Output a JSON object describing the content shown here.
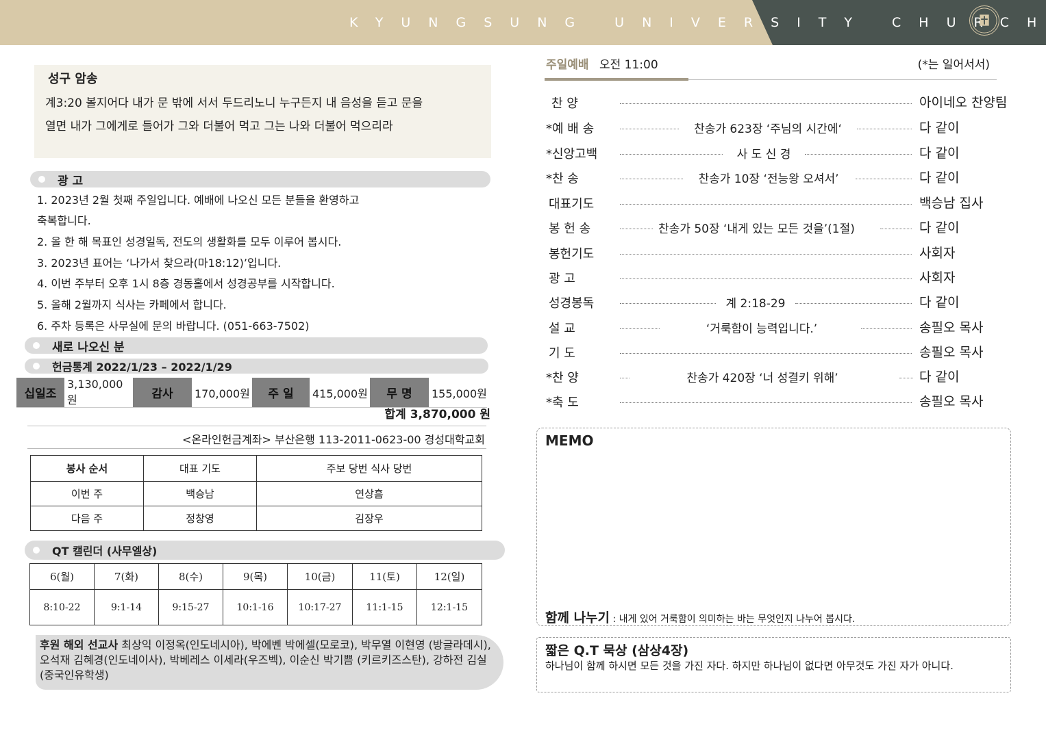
{
  "header": {
    "title": "KYUNGSUNG UNIVERSITY CHURCH"
  },
  "verse": {
    "title": "성구 암송",
    "lines": [
      "계3:20 볼지어다 내가 문 밖에 서서 두드리노니 누구든지 내 음성을 듣고 문을",
      "열면 내가 그에게로 들어가 그와 더불어 먹고 그는 나와 더불어 먹으리라"
    ]
  },
  "announcements": {
    "title": "광   고",
    "lines": [
      "1. 2023년 2월 첫째 주일입니다. 예배에 나오신 모든 분들을 환영하고",
      "축복합니다.",
      "2. 올 한 해 목표인 성경일독, 전도의 생활화를 모두 이루어 봅시다.",
      "3. 2023년 표어는 ‘나가서 찾으라(마18:12)’입니다.",
      "4. 이번 주부터 오후 1시 8층 경동홀에서 성경공부를 시작합니다.",
      "5. 올해 2월까지 식사는 카페에서 합니다.",
      "6. 주차 등록은 사무실에 문의 바랍니다. (051-663-7502)"
    ]
  },
  "newcomers": {
    "title": "새로 나오신 분"
  },
  "offering": {
    "title": "헌금통계 2022/1/23 – 2022/1/29",
    "items": [
      {
        "label": "십일조",
        "value": "3,130,000원"
      },
      {
        "label": "감사",
        "value": "170,000원"
      },
      {
        "label": "주 일",
        "value": "415,000원"
      },
      {
        "label": "무 명",
        "value": "155,000원"
      }
    ],
    "total": "합계  3,870,000 원",
    "account": "<온라인헌금계좌> 부산은행 113-2011-0623-00 경성대학교회"
  },
  "service_duty": {
    "headers": [
      "봉사 순서",
      "대표 기도",
      "주보 당번 식사 당번"
    ],
    "rows": [
      [
        "이번 주",
        "백승남",
        "연상흠"
      ],
      [
        "다음 주",
        "정창영",
        "김장우"
      ]
    ]
  },
  "qt_calendar": {
    "title": "QT 캘린더 (사무엘상)",
    "days": [
      "6(월)",
      "7(화)",
      "8(수)",
      "9(목)",
      "10(금)",
      "11(토)",
      "12(일)"
    ],
    "passages": [
      "8:10-22",
      "9:1-14",
      "9:15-27",
      "10:1-16",
      "10:17-27",
      "11:1-15",
      "12:1-15"
    ]
  },
  "missionaries": {
    "label": "후원 해외 선교사",
    "text": " 최상익 이정옥(인도네시아), 박에벤 박에셀(모로코), 박무열 이현영 (방글라데시), 오석재 김혜경(인도네이사), 박베레스 이세라(우즈벡), 이순신 박기쁨 (키르키즈스탄), 강하전 김실(중국인유학생)"
  },
  "worship": {
    "title": "주일예배",
    "time": "오전 11:00",
    "note": "(*는 일어서서)",
    "order": [
      {
        "name": "찬    양",
        "content": "",
        "who": "아이네오 찬양팀"
      },
      {
        "name": "*예 배 송",
        "content": "찬송가 623장 ‘주님의 시간에‘",
        "who": "다 같이"
      },
      {
        "name": "*신앙고백",
        "content": "사 도 신 경",
        "who": "다 같이"
      },
      {
        "name": "*찬    송",
        "content": "찬송가 10장 ‘전능왕 오셔서’",
        "who": "다 같이"
      },
      {
        "name": "대표기도",
        "content": "",
        "who": "백승남 집사"
      },
      {
        "name": "봉 헌 송",
        "content": "찬송가 50장 ‘내게 있는 모든 것을’(1절)",
        "who": "다 같이"
      },
      {
        "name": "봉헌기도",
        "content": "",
        "who": "사회자"
      },
      {
        "name": "광    고",
        "content": "",
        "who": "사회자"
      },
      {
        "name": "성경봉독",
        "content": "계 2:18-29",
        "who": "다 같이"
      },
      {
        "name": "설    교",
        "content": "‘거룩함이 능력입니다.’",
        "who": "송필오 목사"
      },
      {
        "name": "기    도",
        "content": "",
        "who": "송필오 목사"
      },
      {
        "name": "*찬    양",
        "content": "찬송가 420장  ‘너 성결키 위해’",
        "who": "다 같이"
      },
      {
        "name": "*축    도",
        "content": "",
        "who": "송필오 목사"
      }
    ]
  },
  "memo": {
    "title": "MEMO",
    "share_label": "함께 나누기",
    "share_text": " : 내게 있어 거룩함이 의미하는 바는 무엇인지 나누어 봅시다."
  },
  "qt_meditation": {
    "title": "짧은 Q.T 묵상 (삼상4장)",
    "text": "하나님이 함께 하시면 모든 것을 가진 자다. 하지만 하나님이 없다면 아무것도 가진 자가 아니다."
  }
}
